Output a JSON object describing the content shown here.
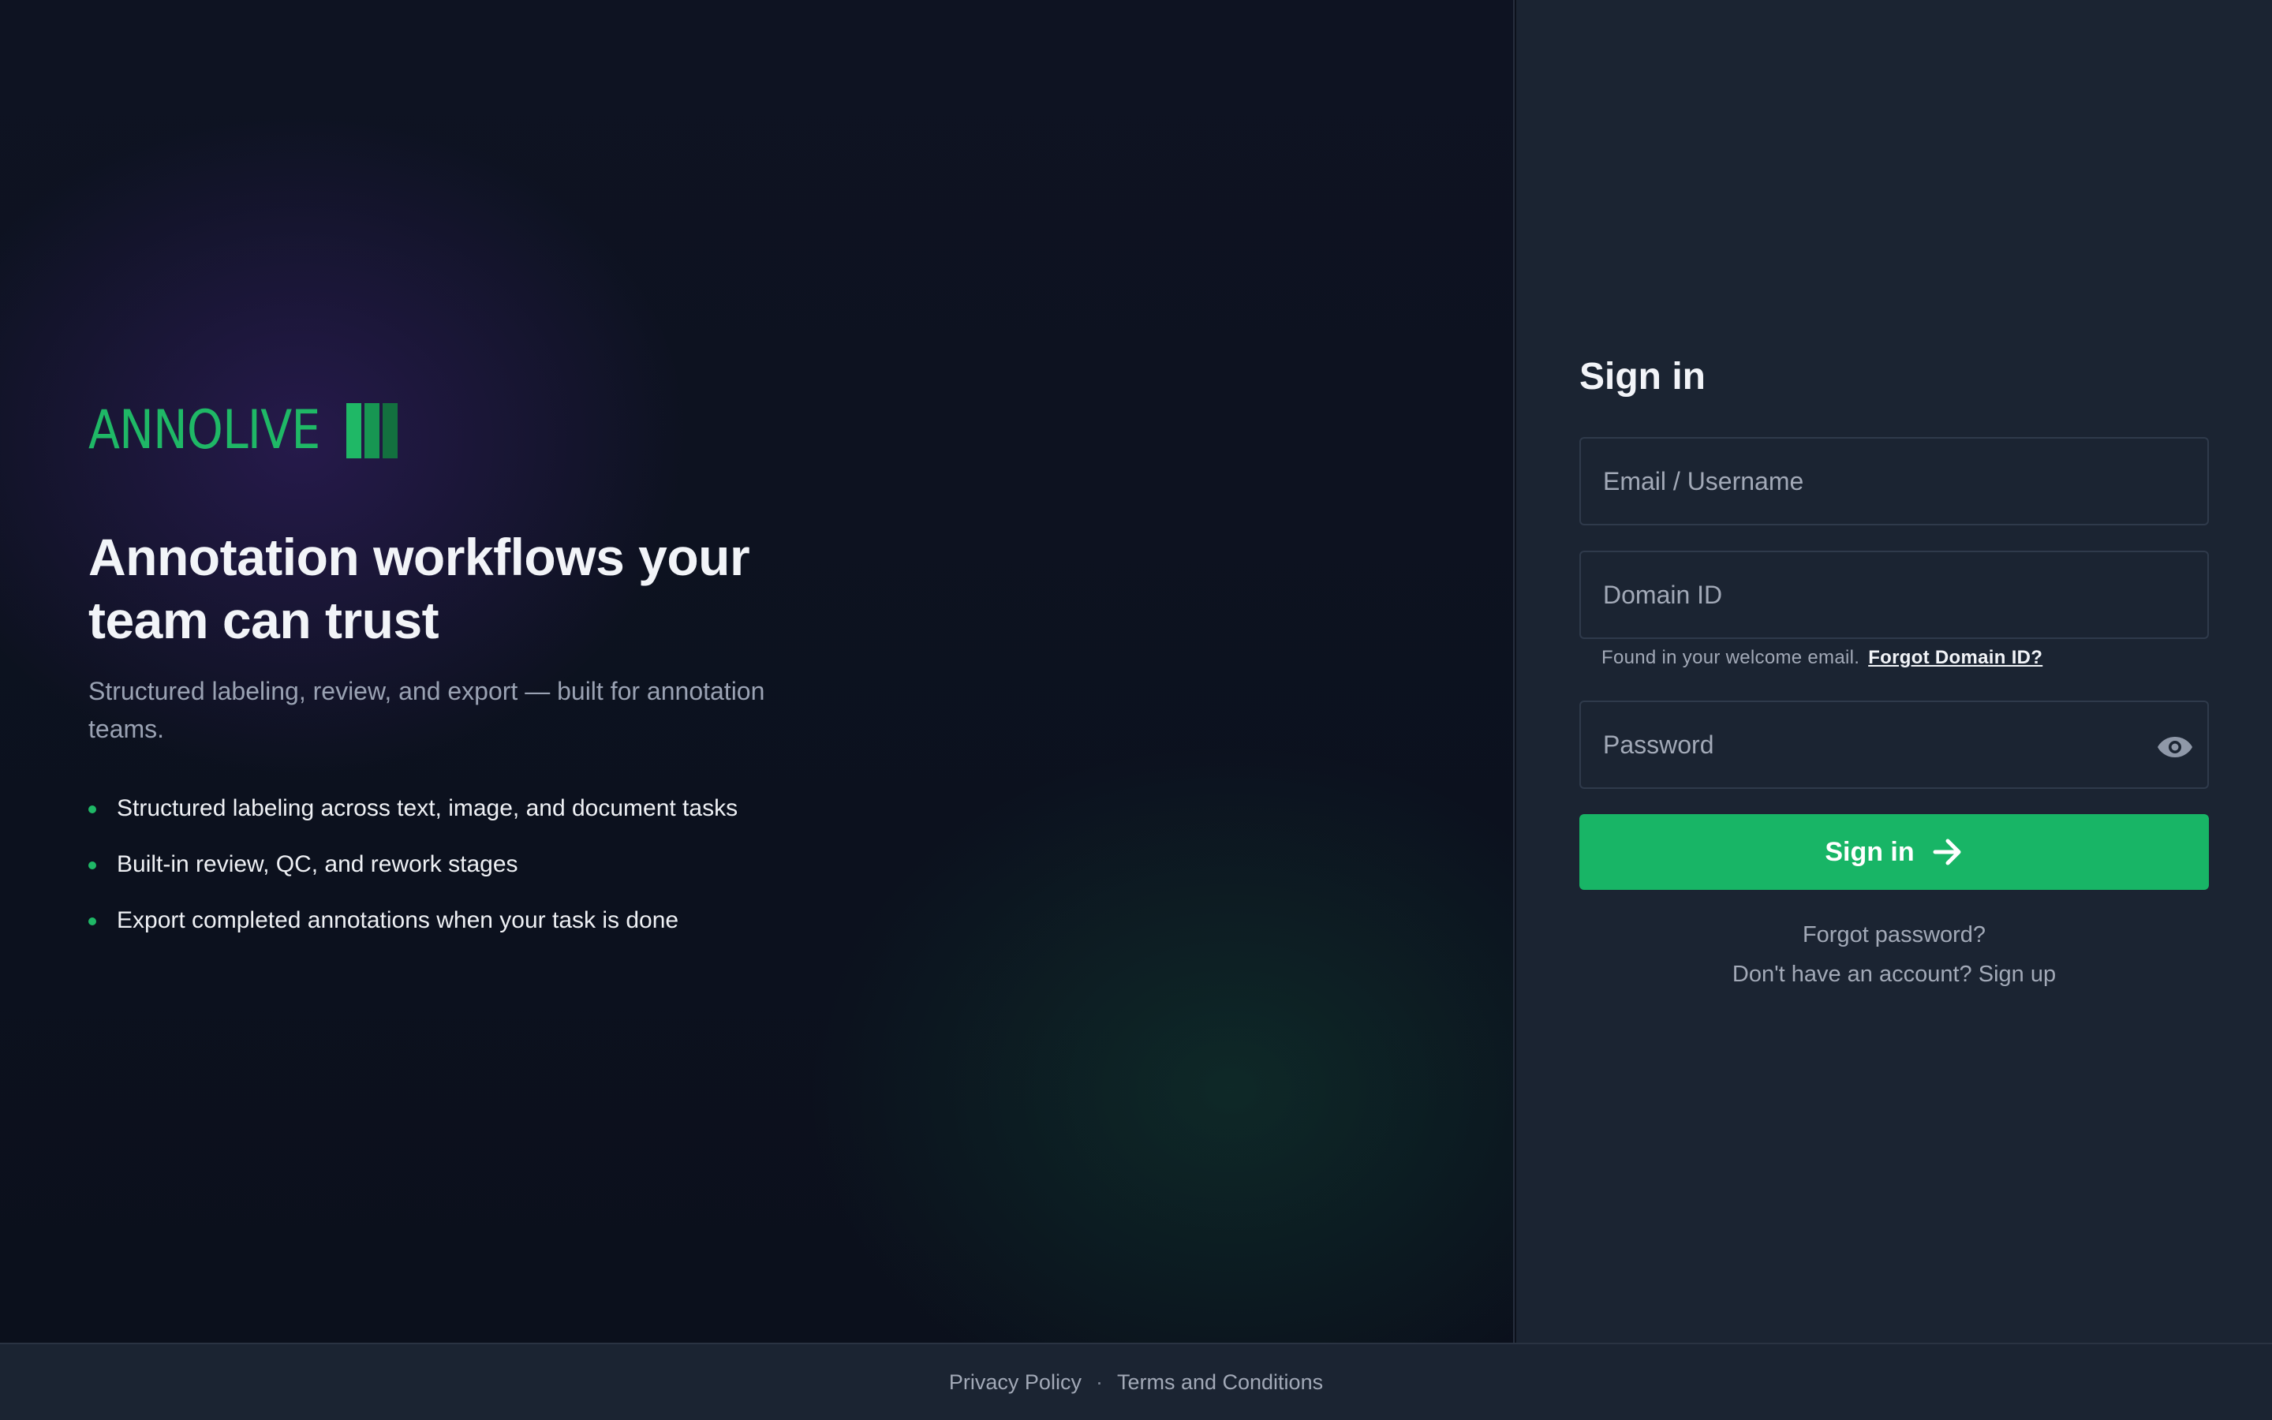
{
  "brand": {
    "name": "ANNOLIVE",
    "colors": {
      "primary": "#1fb866",
      "mid": "#179652",
      "dark": "#13703f"
    }
  },
  "hero": {
    "headline": "Annotation workflows your team can trust",
    "subtitle": "Structured labeling, review, and export — built for annotation teams.",
    "features": [
      "Structured labeling across text, image, and document tasks",
      "Built-in review, QC, and rework stages",
      "Export completed annotations when your task is done"
    ]
  },
  "form": {
    "title": "Sign in",
    "email": {
      "value": "",
      "placeholder": "Email / Username"
    },
    "domain": {
      "value": "",
      "placeholder": "Domain ID"
    },
    "domain_hint": "Found in your welcome email.",
    "forgot_domain_label": "Forgot Domain ID?",
    "password": {
      "value": "",
      "placeholder": "Password",
      "toggle_icon": "eye-icon"
    },
    "submit_label": "Sign in",
    "submit_icon": "arrow-right-icon",
    "forgot_password_label": "Forgot password?",
    "signup_prompt": "Don't have an account?",
    "signup_label": "Sign up"
  },
  "footer": {
    "privacy_label": "Privacy Policy",
    "separator": "·",
    "terms_label": "Terms and Conditions"
  },
  "colors": {
    "accent": "#18b566",
    "panel_bg": "#1b2432",
    "hero_bg": "#0c111b"
  }
}
